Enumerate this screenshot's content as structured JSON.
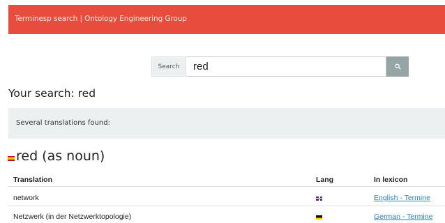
{
  "navbar": {
    "brand": "Terminesp search | Ontology Engineering Group",
    "bg_color": "#e74c3c"
  },
  "search": {
    "addon_label": "Search",
    "value": "red",
    "button_icon": "search-icon",
    "button_color": "#95a5a6"
  },
  "results": {
    "your_search": "Your search: red",
    "alert_message": "Several translations found:",
    "term_flag": "spain-flag-icon",
    "term_heading": "red (as noun)",
    "table": {
      "columns": [
        "Translation",
        "Lang",
        "In lexicon"
      ],
      "rows": [
        {
          "translation": "network",
          "lang_icon": "uk-flag-icon",
          "lexicon": "English - Termine"
        },
        {
          "translation": "Netzwerk (in der Netzwerktopologie)",
          "lang_icon": "germany-flag-icon",
          "lexicon": "German - Termine"
        }
      ]
    }
  }
}
